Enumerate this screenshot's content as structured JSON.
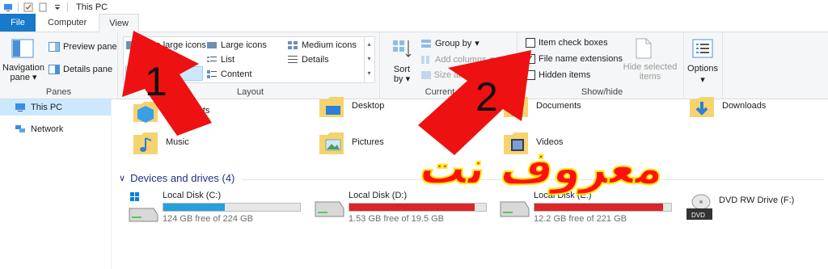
{
  "window": {
    "title": "This PC"
  },
  "tabs": [
    "File",
    "Computer",
    "View"
  ],
  "ribbon": {
    "panes": {
      "label": "Panes",
      "navigation_pane": "Navigation pane",
      "preview_pane": "Preview pane",
      "details_pane": "Details pane"
    },
    "layout": {
      "label": "Layout",
      "items": [
        "Extra large icons",
        "Large icons",
        "Medium icons",
        "List",
        "Details",
        "Content"
      ]
    },
    "current_view": {
      "label": "Current view",
      "sort_by": "Sort by",
      "group_by": "Group by",
      "add_columns": "Add columns",
      "size_all": "Size all columns to fit"
    },
    "show_hide": {
      "label": "Show/hide",
      "item_check_boxes": "Item check boxes",
      "file_name_extensions": "File name extensions",
      "hidden_items": "Hidden items",
      "hide_selected": "Hide selected items",
      "checks": {
        "item_check_boxes": false,
        "file_name_extensions": true,
        "hidden_items": false
      }
    },
    "options": {
      "label": "Options"
    }
  },
  "nav": [
    {
      "label": "This PC",
      "selected": true
    },
    {
      "label": "Network",
      "selected": false
    }
  ],
  "folders": [
    "3D Objects",
    "Desktop",
    "Documents",
    "Downloads",
    "Music",
    "Pictures",
    "Videos"
  ],
  "devices": {
    "header": "Devices and drives (4)",
    "drives": [
      {
        "name": "Local Disk (C:)",
        "free": "124 GB free of 224 GB",
        "used_fraction": 0.45,
        "color": "#26a0da"
      },
      {
        "name": "Local Disk (D:)",
        "free": "1.53 GB free of 19.5 GB",
        "used_fraction": 0.92,
        "color": "#da2626"
      },
      {
        "name": "Local Disk (E:)",
        "free": "12.2 GB free of 221 GB",
        "used_fraction": 0.94,
        "color": "#da2626"
      },
      {
        "name": "DVD RW Drive (F:)",
        "free": "",
        "used_fraction": 0,
        "color": "#26a0da"
      }
    ]
  },
  "annotations": {
    "step1": "1",
    "step2": "2",
    "watermark": "معروف نت"
  }
}
